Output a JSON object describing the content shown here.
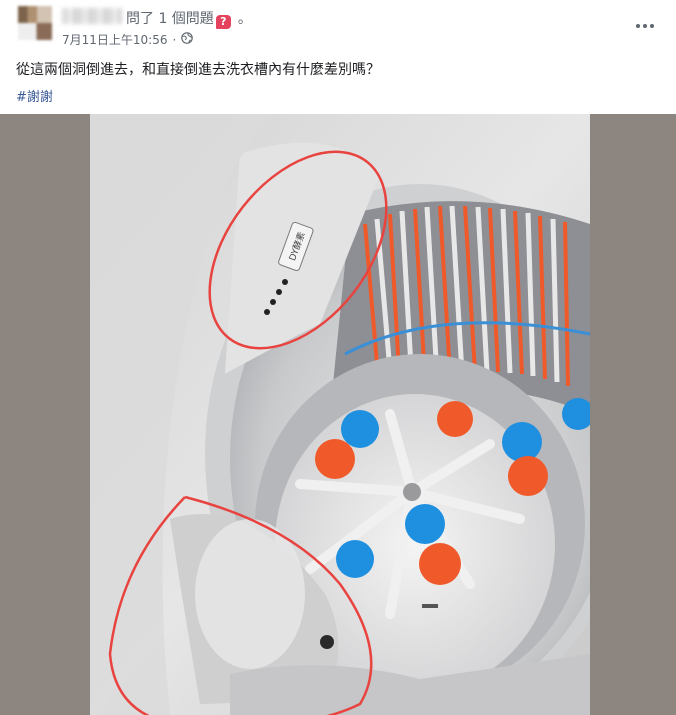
{
  "post": {
    "author_name": "",
    "action_text": "問了 1 個問題",
    "question_badge": "?",
    "action_suffix": "。",
    "timestamp": "7月11日上午10:56",
    "separator": "·",
    "body_text": "從這兩個洞倒進去，和直接倒進去洗衣槽內有什麼差別嗎？",
    "hashtag": "#謝謝"
  },
  "photo": {
    "label_on_part": "DY酵素",
    "colors": {
      "annotation_circle": "#e8433f",
      "ball_blue": "#1f8fe0",
      "ball_orange": "#f05a2a",
      "washer_body": "#dcdcdc"
    }
  },
  "icons": {
    "privacy": "globe-icon",
    "more": "more-horizontal-icon"
  }
}
